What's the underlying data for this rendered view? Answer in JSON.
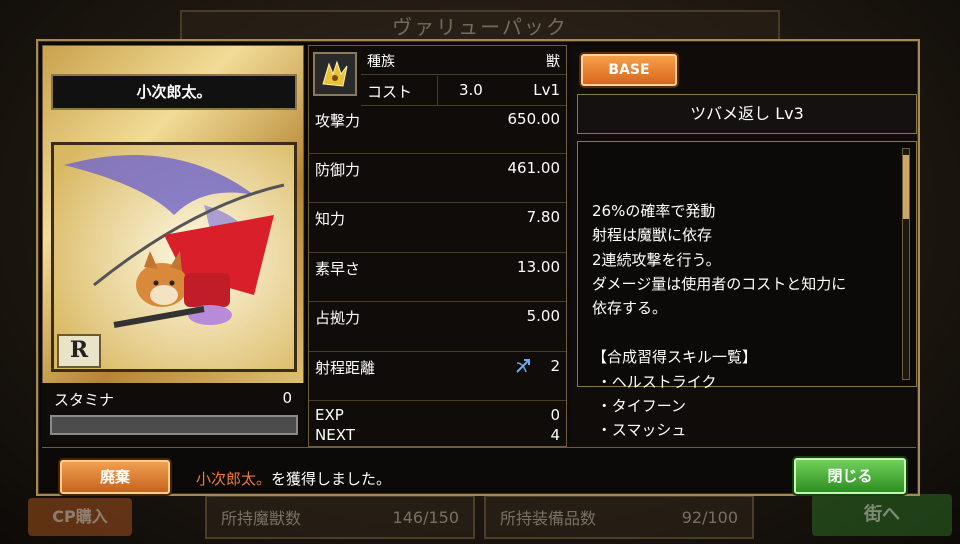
{
  "background": {
    "title": "ヴァリューパック",
    "cp_button": "CP購入",
    "monster_count_label": "所持魔獣数",
    "monster_count_value": "146/150",
    "equipment_count_label": "所持装備品数",
    "equipment_count_value": "92/100",
    "town_button": "街へ"
  },
  "card": {
    "name": "小次郎太。",
    "rank": "R",
    "stamina_label": "スタミナ",
    "stamina_value": "0",
    "stamina_fill": 0
  },
  "stats": {
    "breed_label": "種族",
    "breed_value": "獣",
    "breed_icon": "beast-crest-icon",
    "cost_label": "コスト",
    "cost_value": "3.0",
    "level": "Lv1",
    "rows": [
      {
        "label": "攻撃力",
        "value": "650.00"
      },
      {
        "label": "防御力",
        "value": "461.00"
      },
      {
        "label": "知力",
        "value": "7.80"
      },
      {
        "label": "素早さ",
        "value": "13.00"
      },
      {
        "label": "占拠力",
        "value": "5.00"
      },
      {
        "label": "射程距離",
        "value": "2",
        "icon": "bow-arrow-icon"
      }
    ],
    "exp_label": "EXP",
    "exp_value": "0",
    "next_label": "NEXT",
    "next_value": "4"
  },
  "skill": {
    "base_button": "BASE",
    "name": "ツバメ返し Lv3",
    "description": "26%の確率で発動\n射程は魔獣に依存\n2連続攻撃を行う。\nダメージ量は使用者のコストと知力に\n依存する。\n\n【合成習得スキル一覧】\n ・ヘルストライク\n ・タイフーン\n ・スマッシュ"
  },
  "footer": {
    "dispose_button": "廃棄",
    "message_name": "小次郎太。",
    "message_rest": "を獲得しました。",
    "close_button": "閉じる"
  },
  "colors": {
    "frame_gold": "#a58a55",
    "orange_button": "#d8661c",
    "green_button": "#2e8f22",
    "highlight_text": "#f07a3a"
  }
}
